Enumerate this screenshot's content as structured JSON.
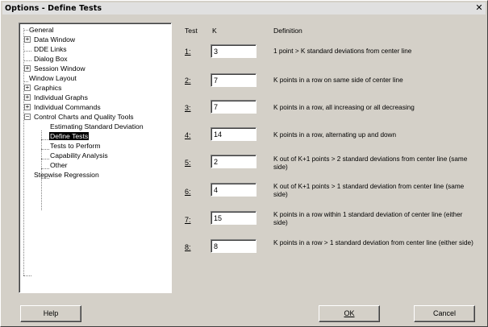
{
  "window": {
    "title": "Options - Define Tests",
    "close_glyph": "✕"
  },
  "tree": {
    "items": [
      {
        "label": "General",
        "expandable": false
      },
      {
        "label": "Data Window",
        "expandable": true
      },
      {
        "label": "DDE Links",
        "expandable": false
      },
      {
        "label": "Dialog Box",
        "expandable": false
      },
      {
        "label": "Session Window",
        "expandable": true
      },
      {
        "label": "Window Layout",
        "expandable": false
      },
      {
        "label": "Graphics",
        "expandable": true
      },
      {
        "label": "Individual Graphs",
        "expandable": true
      },
      {
        "label": "Individual Commands",
        "expandable": true
      },
      {
        "label": "Control Charts and Quality Tools",
        "expandable": true,
        "expanded": true
      },
      {
        "label": "Estimating Standard Deviation",
        "child": true
      },
      {
        "label": "Define Tests",
        "child": true,
        "selected": true
      },
      {
        "label": "Tests to Perform",
        "child": true
      },
      {
        "label": "Capability Analysis",
        "child": true
      },
      {
        "label": "Other",
        "child": true
      },
      {
        "label": "Stepwise Regression",
        "expandable": false
      }
    ]
  },
  "headers": {
    "test": "Test",
    "k": "K",
    "definition": "Definition"
  },
  "tests": [
    {
      "num": "1:",
      "k": "3",
      "definition": "1 point > K standard deviations from center line"
    },
    {
      "num": "2:",
      "k": "7",
      "definition": "K points in a row on same side of center line"
    },
    {
      "num": "3:",
      "k": "7",
      "definition": "K points in a row, all increasing or all decreasing"
    },
    {
      "num": "4:",
      "k": "14",
      "definition": "K points in a row, alternating up and down"
    },
    {
      "num": "5:",
      "k": "2",
      "definition": "K out of K+1 points > 2 standard deviations from center line (same side)"
    },
    {
      "num": "6:",
      "k": "4",
      "definition": "K out of K+1 points > 1 standard deviation from center line (same side)"
    },
    {
      "num": "7:",
      "k": "15",
      "definition": "K points in a row within 1 standard deviation of center line (either side)"
    },
    {
      "num": "8:",
      "k": "8",
      "definition": "K points in a row > 1 standard deviation from center line (either side)"
    }
  ],
  "buttons": {
    "help": "Help",
    "ok": "OK",
    "cancel": "Cancel"
  }
}
